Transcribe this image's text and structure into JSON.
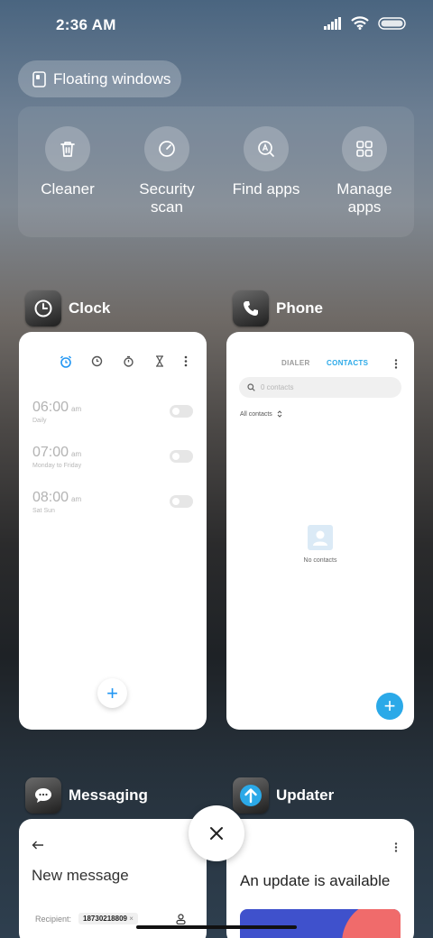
{
  "status_bar": {
    "time": "2:36 AM"
  },
  "floating_windows": {
    "label": "Floating windows"
  },
  "quick_actions": [
    {
      "label": "Cleaner",
      "icon": "trash-icon"
    },
    {
      "label": "Security\nscan",
      "icon": "shield-scan-icon"
    },
    {
      "label": "Find apps",
      "icon": "find-apps-icon"
    },
    {
      "label": "Manage\napps",
      "icon": "grid-icon"
    }
  ],
  "apps": {
    "clock": {
      "name": "Clock",
      "alarms": [
        {
          "time": "06:00",
          "ampm": "am",
          "repeat": "Daily"
        },
        {
          "time": "07:00",
          "ampm": "am",
          "repeat": "Monday to Friday"
        },
        {
          "time": "08:00",
          "ampm": "am",
          "repeat": "Sat Sun"
        }
      ],
      "add_label": "+"
    },
    "phone": {
      "name": "Phone",
      "tabs": [
        "DIALER",
        "CONTACTS"
      ],
      "search_placeholder": "0 contacts",
      "filter_label": "All contacts",
      "empty_text": "No contacts",
      "add_label": "+"
    },
    "messaging": {
      "name": "Messaging",
      "title": "New message",
      "recipient_label": "Recipient:",
      "recipient_value": "18730218809"
    },
    "updater": {
      "name": "Updater",
      "title": "An update is available"
    }
  },
  "colors": {
    "accent_blue": "#2196f3",
    "contacts_blue": "#2ba9e8"
  }
}
